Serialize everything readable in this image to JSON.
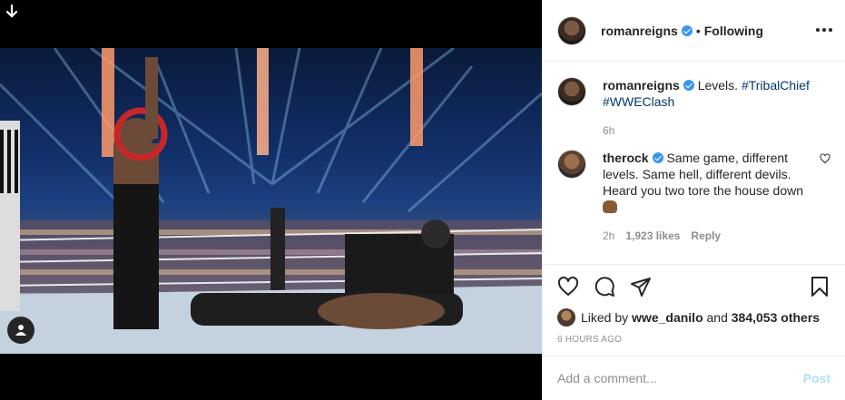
{
  "post": {
    "username": "romanreigns",
    "separator": "•",
    "follow_state": "Following",
    "caption": {
      "username": "romanreigns",
      "text": "Levels.",
      "hashtags": [
        "#TribalChief",
        "#WWEClash"
      ],
      "age": "6h"
    },
    "comments": [
      {
        "username": "therock",
        "text": "Same game, different levels. Same hell, different devils. Heard you two tore the house down",
        "age": "2h",
        "likes": "1,923 likes",
        "reply_label": "Reply"
      }
    ],
    "liked_by_prefix": "Liked by",
    "liked_by_user": "wwe_danilo",
    "liked_by_and": "and",
    "liked_by_others": "384,053 others",
    "timestamp": "6 HOURS AGO",
    "comment_placeholder": "Add a comment...",
    "post_label": "Post"
  },
  "icons": {
    "download": "arrow-down-icon",
    "user_tag": "user-tag-icon",
    "more": "more-options-icon",
    "verified": "verified-badge-icon",
    "like": "heart-icon",
    "comment": "comment-icon",
    "share": "share-icon",
    "save": "bookmark-icon",
    "emoji": "fist-emoji-icon"
  },
  "colors": {
    "verified": "#3897f0",
    "hashtag": "#00376b",
    "muted": "#8e8e8e",
    "post_disabled": "#b2dffc"
  }
}
